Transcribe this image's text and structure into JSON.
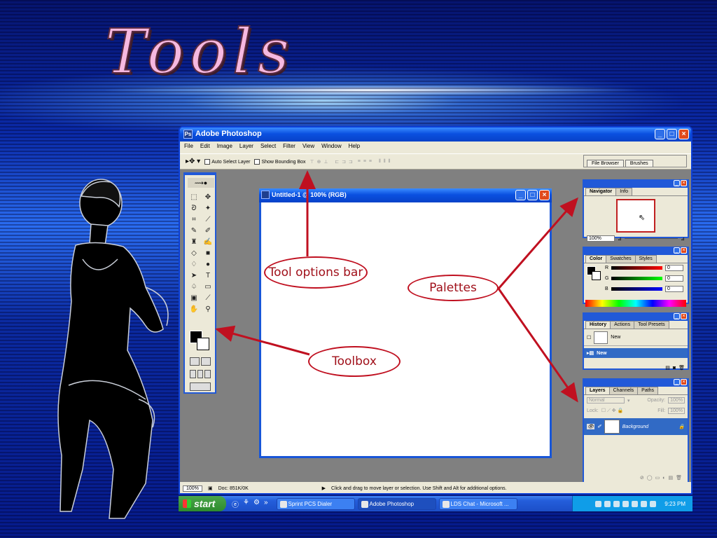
{
  "slide": {
    "title": "Tools"
  },
  "app": {
    "title": "Adobe Photoshop",
    "menu": [
      "File",
      "Edit",
      "Image",
      "Layer",
      "Select",
      "Filter",
      "View",
      "Window",
      "Help"
    ],
    "options_bar": {
      "auto_select": "Auto Select Layer",
      "bounding_box": "Show Bounding Box"
    },
    "palette_well": [
      "File Browser",
      "Brushes"
    ],
    "status": {
      "zoom": "100%",
      "doc": "Doc: 851K/0K",
      "hint": "Click and drag to move layer or selection. Use Shift and Alt for additional options."
    }
  },
  "document": {
    "title": "Untitled-1 @ 100% (RGB)"
  },
  "palettes": {
    "navigator": {
      "tabs": [
        "Navigator",
        "Info"
      ],
      "zoom": "100%"
    },
    "color": {
      "tabs": [
        "Color",
        "Swatches",
        "Styles"
      ],
      "r": "0",
      "g": "0",
      "b": "0",
      "r_label": "R",
      "g_label": "G",
      "b_label": "B"
    },
    "history": {
      "tabs": [
        "History",
        "Actions",
        "Tool Presets"
      ],
      "snapshot": "New",
      "state": "New"
    },
    "layers": {
      "tabs": [
        "Layers",
        "Channels",
        "Paths"
      ],
      "blend": "Normal",
      "opacity_label": "Opacity:",
      "opacity": "100%",
      "lock_label": "Lock:",
      "fill_label": "Fill:",
      "fill": "100%",
      "layer": "Background"
    }
  },
  "callouts": {
    "options": "Tool options bar",
    "palettes": "Palettes",
    "toolbox": "Toolbox"
  },
  "taskbar": {
    "start": "start",
    "tasks": [
      "Sprint PCS Dialer",
      "Adobe Photoshop",
      "LDS Chat - Microsoft ..."
    ],
    "clock": "9:23 PM"
  },
  "colors": {
    "accent": "#0b3fd6",
    "callout": "#c01020",
    "title": "#f6b8e0"
  }
}
